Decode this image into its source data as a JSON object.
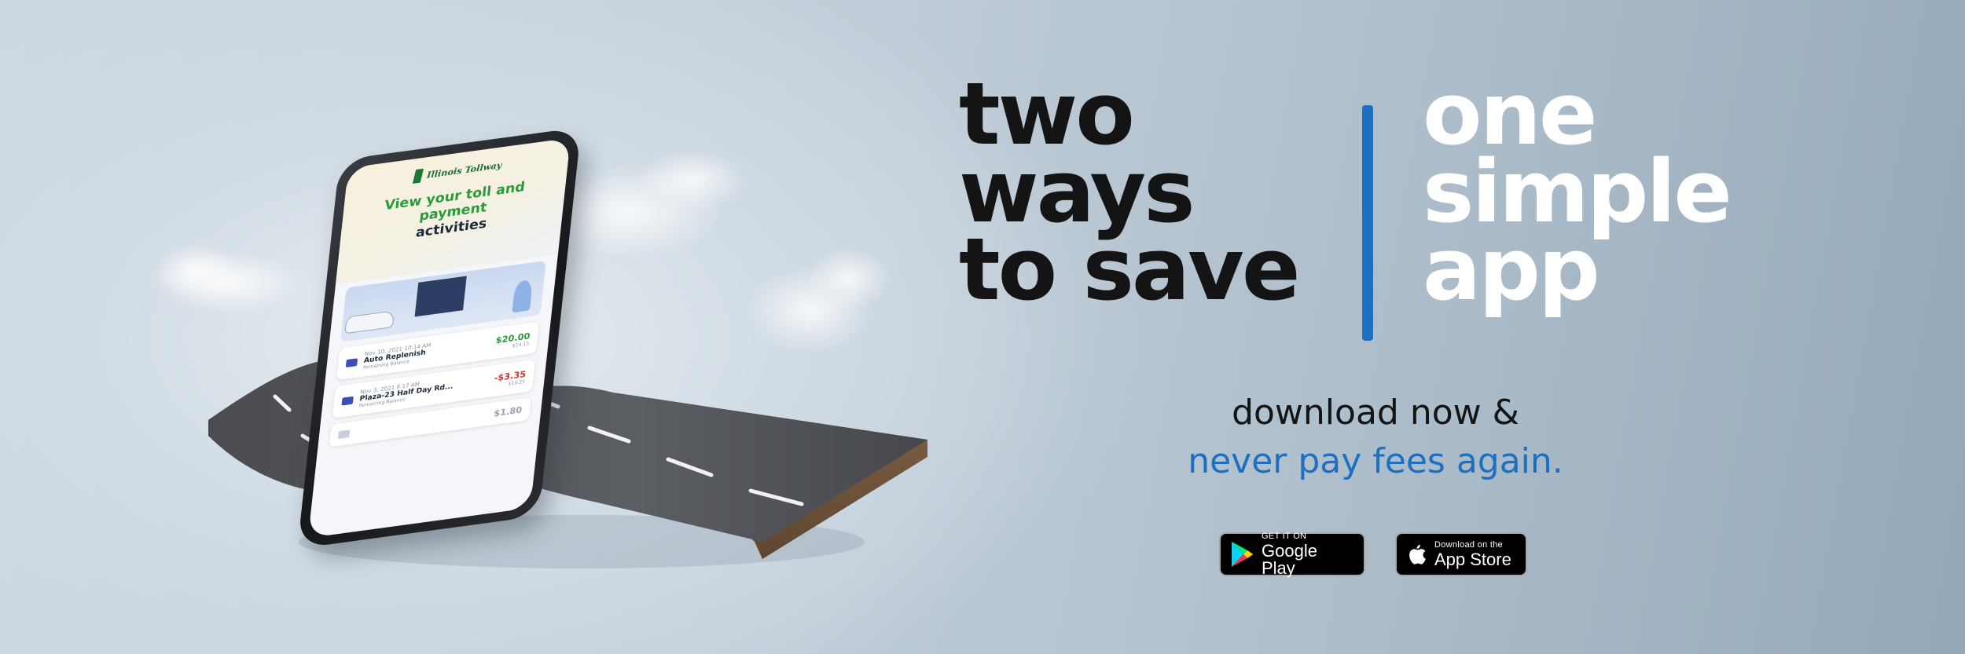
{
  "headline": {
    "left_lines": [
      "two",
      "ways",
      "to save"
    ],
    "right_lines": [
      "one",
      "simple",
      "app"
    ]
  },
  "subhead": {
    "line1": "download now &",
    "line2": "never pay fees again."
  },
  "badges": {
    "google_play": {
      "small": "GET IT ON",
      "big": "Google Play",
      "icon": "google-play-icon"
    },
    "app_store": {
      "small": "Download on the",
      "big": "App Store",
      "icon": "apple-icon"
    }
  },
  "phone_screen": {
    "logo": "Illinois Tollway",
    "title_line1": "View your toll and payment",
    "title_line2": "activities",
    "transactions": [
      {
        "date": "Nov 10, 2021  10:14 AM",
        "name": "Auto Replenish",
        "sub": "Remaining Balance",
        "amount": "$20.00",
        "amount_type": "pos",
        "balance": "$14.15"
      },
      {
        "date": "Nov 3, 2021  8:17 AM",
        "name": "Plaza-23 Half Day Rd...",
        "sub": "Remaining Balance",
        "amount": "-$3.35",
        "amount_type": "neg",
        "balance": "$10.25"
      },
      {
        "date": "",
        "name": "",
        "sub": "",
        "amount": "$1.80",
        "amount_type": "pos",
        "balance": ""
      }
    ]
  },
  "colors": {
    "accent_blue": "#1f6fc0",
    "headline_dark": "#141414",
    "headline_light": "#ffffff",
    "tollway_green": "#2a9a3a"
  }
}
